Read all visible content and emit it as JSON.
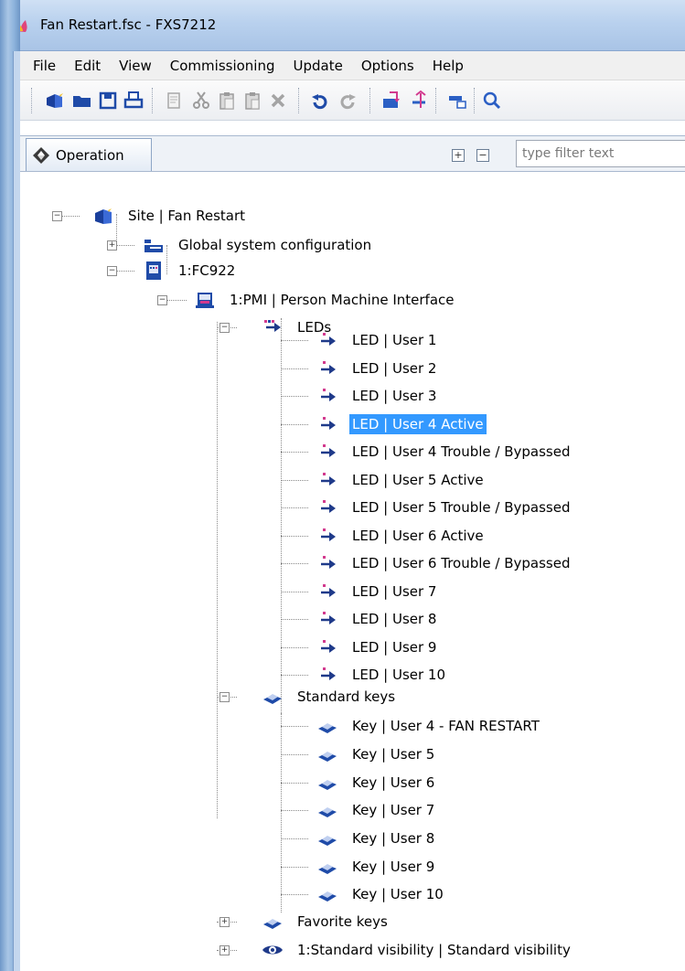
{
  "window": {
    "title": "Fan Restart.fsc - FXS7212"
  },
  "menu": [
    "File",
    "Edit",
    "View",
    "Commissioning",
    "Update",
    "Options",
    "Help"
  ],
  "toolbar_icons": [
    "new-icon",
    "open-icon",
    "save-icon",
    "print-icon",
    "copy-icon",
    "cut-icon",
    "paste-icon",
    "paste-special-icon",
    "delete-icon",
    "undo-icon",
    "redo-icon",
    "import-icon",
    "export-icon",
    "properties-icon",
    "search-icon"
  ],
  "panel": {
    "tab_label": "Operation",
    "filter_placeholder": "type filter text"
  },
  "tree": {
    "site": "Site | Fan Restart",
    "global": "Global system configuration",
    "panel_node": "1:FC922",
    "pmi": "1:PMI | Person Machine Interface",
    "leds_label": "LEDs",
    "leds": [
      "LED | User 1",
      "LED | User 2",
      "LED | User 3",
      "LED | User 4 Active",
      "LED | User 4 Trouble / Bypassed",
      "LED | User 5 Active",
      "LED | User 5 Trouble / Bypassed",
      "LED | User 6 Active",
      "LED | User 6 Trouble / Bypassed",
      "LED | User 7",
      "LED | User 8",
      "LED | User 9",
      "LED | User 10"
    ],
    "selected_led_index": 3,
    "keys_label": "Standard keys",
    "keys": [
      "Key | User 4 - FAN RESTART",
      "Key | User 5",
      "Key | User 6",
      "Key | User 7",
      "Key | User 8",
      "Key | User 9",
      "Key | User 10"
    ],
    "favorite_keys": "Favorite keys",
    "visibility": "1:Standard visibility | Standard visibility"
  }
}
